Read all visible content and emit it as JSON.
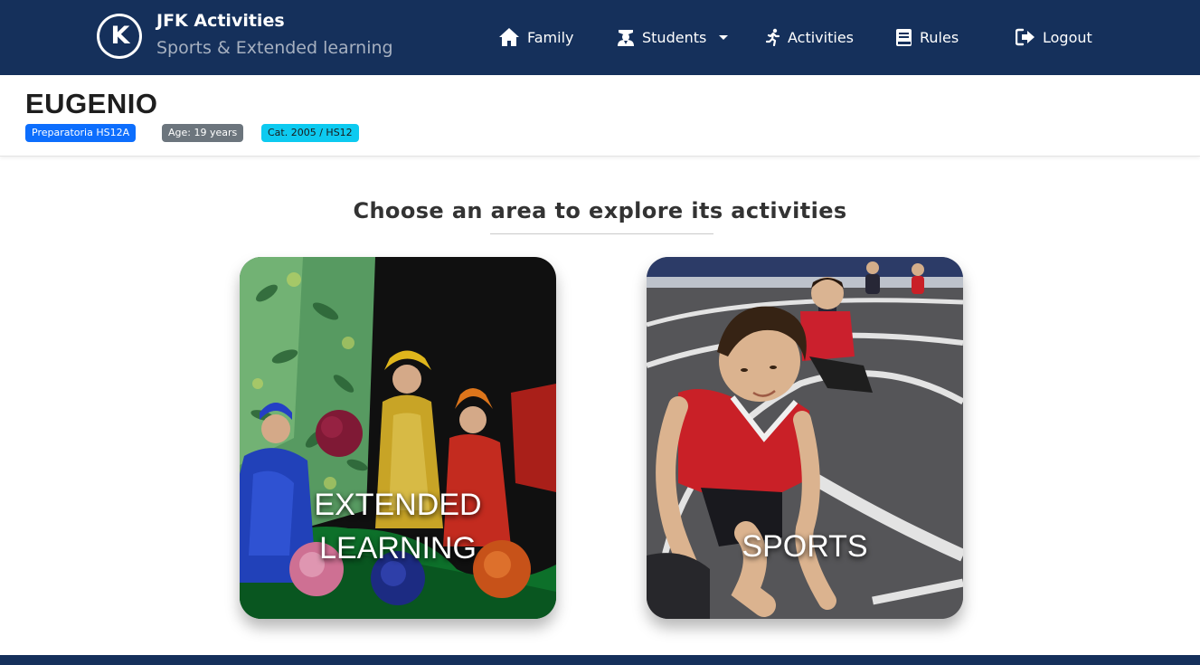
{
  "brand": {
    "logo_letter": "K",
    "title": "JFK Activities",
    "subtitle": "Sports & Extended learning"
  },
  "nav": {
    "family": "Family",
    "students": "Students",
    "activities": "Activities",
    "rules": "Rules",
    "logout": "Logout"
  },
  "student": {
    "name": "EUGENIO",
    "badges": {
      "group": "Preparatoria HS12A",
      "age": "Age: 19 years",
      "category": "Cat. 2005 / HS12"
    }
  },
  "main": {
    "heading": "Choose an area to explore its activities",
    "cards": [
      {
        "label_line1": "EXTENDED",
        "label_line2": "LEARNING"
      },
      {
        "label": "SPORTS"
      }
    ]
  },
  "colors": {
    "navbar": "#15305b",
    "badge_primary": "#0d6efd",
    "badge_secondary": "#6c757d",
    "badge_info": "#0dcaf0"
  }
}
